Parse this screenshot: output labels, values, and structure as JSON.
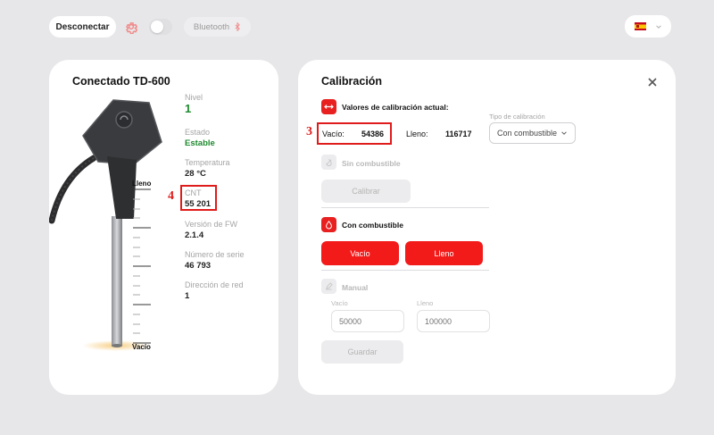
{
  "topbar": {
    "disconnect_label": "Desconectar",
    "bluetooth_label": "Bluetooth",
    "language_flag": "ES"
  },
  "device": {
    "title": "Conectado  TD-600",
    "scale_top": "Lleno",
    "scale_bottom": "Vacío",
    "info": [
      {
        "label": "Nivel",
        "value": "1"
      },
      {
        "label": "Estado",
        "value": "Estable"
      },
      {
        "label": "Temperatura",
        "value": "28 °C"
      },
      {
        "label": "CNT",
        "value": "55 201"
      },
      {
        "label": "Versión de FW",
        "value": "2.1.4"
      },
      {
        "label": "Número de serie",
        "value": "46 793"
      },
      {
        "label": "Dirección de red",
        "value": "1"
      }
    ],
    "annotation_number": "4"
  },
  "calibration": {
    "title": "Calibración",
    "current_values_label": "Valores de calibración actual:",
    "empty_label": "Vacío:",
    "empty_value": "54386",
    "full_label": "Lleno:",
    "full_value": "116717",
    "annotation_number": "3",
    "type_label": "Tipo de calibración",
    "type_selected": "Con combustible",
    "no_fuel_label": "Sin combustible",
    "calibrate_button": "Calibrar",
    "with_fuel_label": "Con combustible",
    "empty_button": "Vacío",
    "full_button": "Lleno",
    "manual_label": "Manual",
    "manual_empty_label": "Vacío",
    "manual_full_label": "Lleno",
    "manual_empty_placeholder": "50000",
    "manual_full_placeholder": "100000",
    "save_button": "Guardar"
  },
  "colors": {
    "accent_red": "#f31a1a",
    "status_green": "#1e8a2f",
    "background": "#e7e7e9"
  }
}
